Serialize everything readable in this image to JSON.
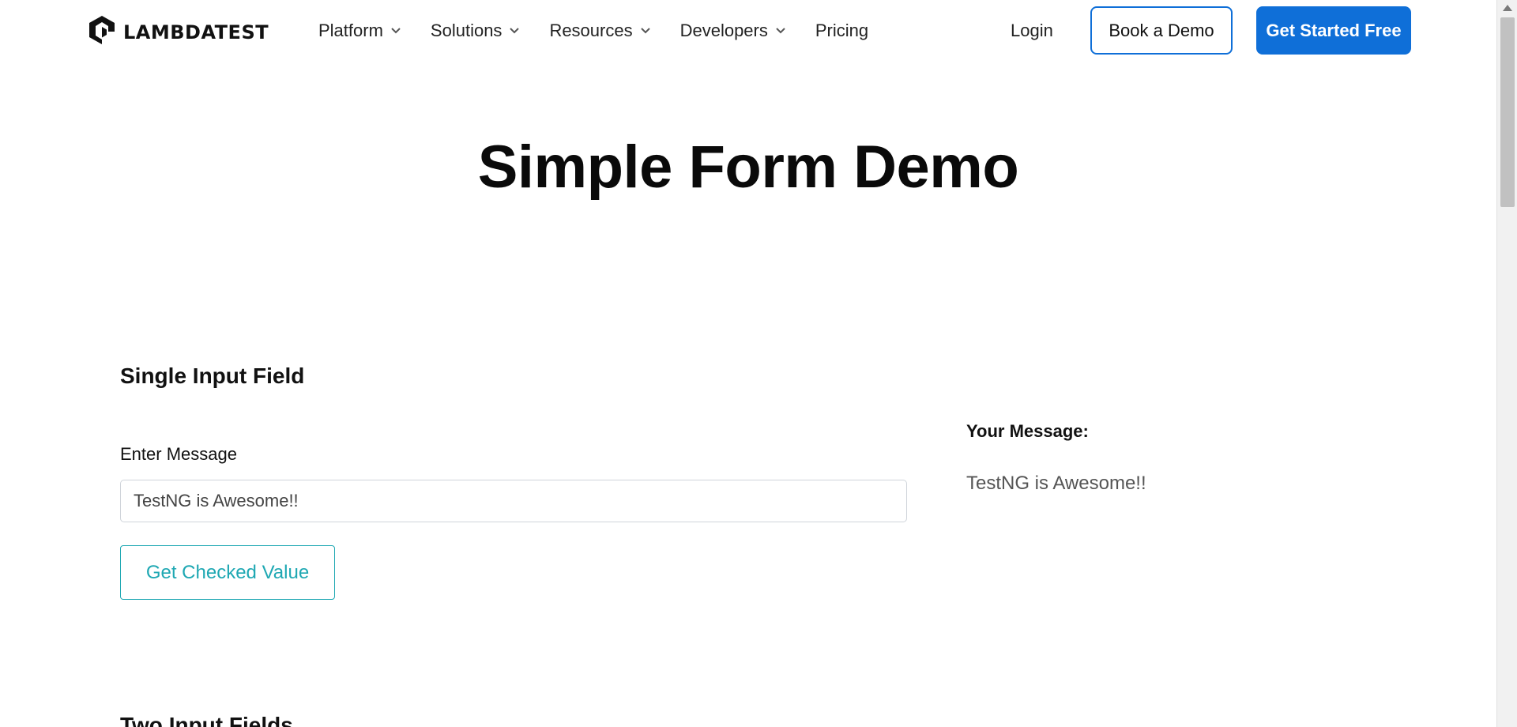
{
  "header": {
    "logo_text": "LAMBDATEST",
    "nav": [
      {
        "label": "Platform",
        "dropdown": true
      },
      {
        "label": "Solutions",
        "dropdown": true
      },
      {
        "label": "Resources",
        "dropdown": true
      },
      {
        "label": "Developers",
        "dropdown": true
      },
      {
        "label": "Pricing",
        "dropdown": false
      }
    ],
    "login_label": "Login",
    "book_demo_label": "Book a Demo",
    "get_started_label": "Get Started Free"
  },
  "page_title": "Simple Form Demo",
  "single_input": {
    "section_title": "Single Input Field",
    "field_label": "Enter Message",
    "input_value": "TestNG is Awesome!!",
    "button_label": "Get Checked Value",
    "your_message_label": "Your Message:",
    "your_message_value": "TestNG is Awesome!!"
  },
  "two_input": {
    "section_title": "Two Input Fields"
  },
  "colors": {
    "brand_blue": "#0f6fd8",
    "teal": "#1fa8b3"
  },
  "icons": {
    "logo": "lambdatest-logo-icon",
    "dropdown": "chevron-down-icon"
  }
}
